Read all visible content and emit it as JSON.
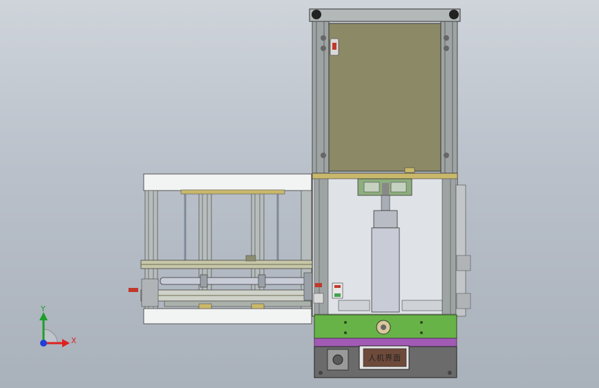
{
  "viewport": {
    "background_top": "#cfd4db",
    "background_bottom": "#a9b1bb"
  },
  "model": {
    "hmi_panel_label": "人机界面",
    "colors": {
      "upper_cabinet_panel": "#8c8a66",
      "frame_profile": "#9ea3a3",
      "green_plate": "#67b347",
      "purple_plate": "#a25bb5",
      "base_plate": "#6b6b6b",
      "hmi_screen": "#6e4a3b",
      "cylinder_body": "#c8ccd6",
      "red_accent": "#c0392b"
    }
  },
  "triad": {
    "x_label": "X",
    "y_label": "Y",
    "x_color": "#e02020",
    "y_color": "#1e9e2a",
    "z_color": "#1f3fd8"
  }
}
